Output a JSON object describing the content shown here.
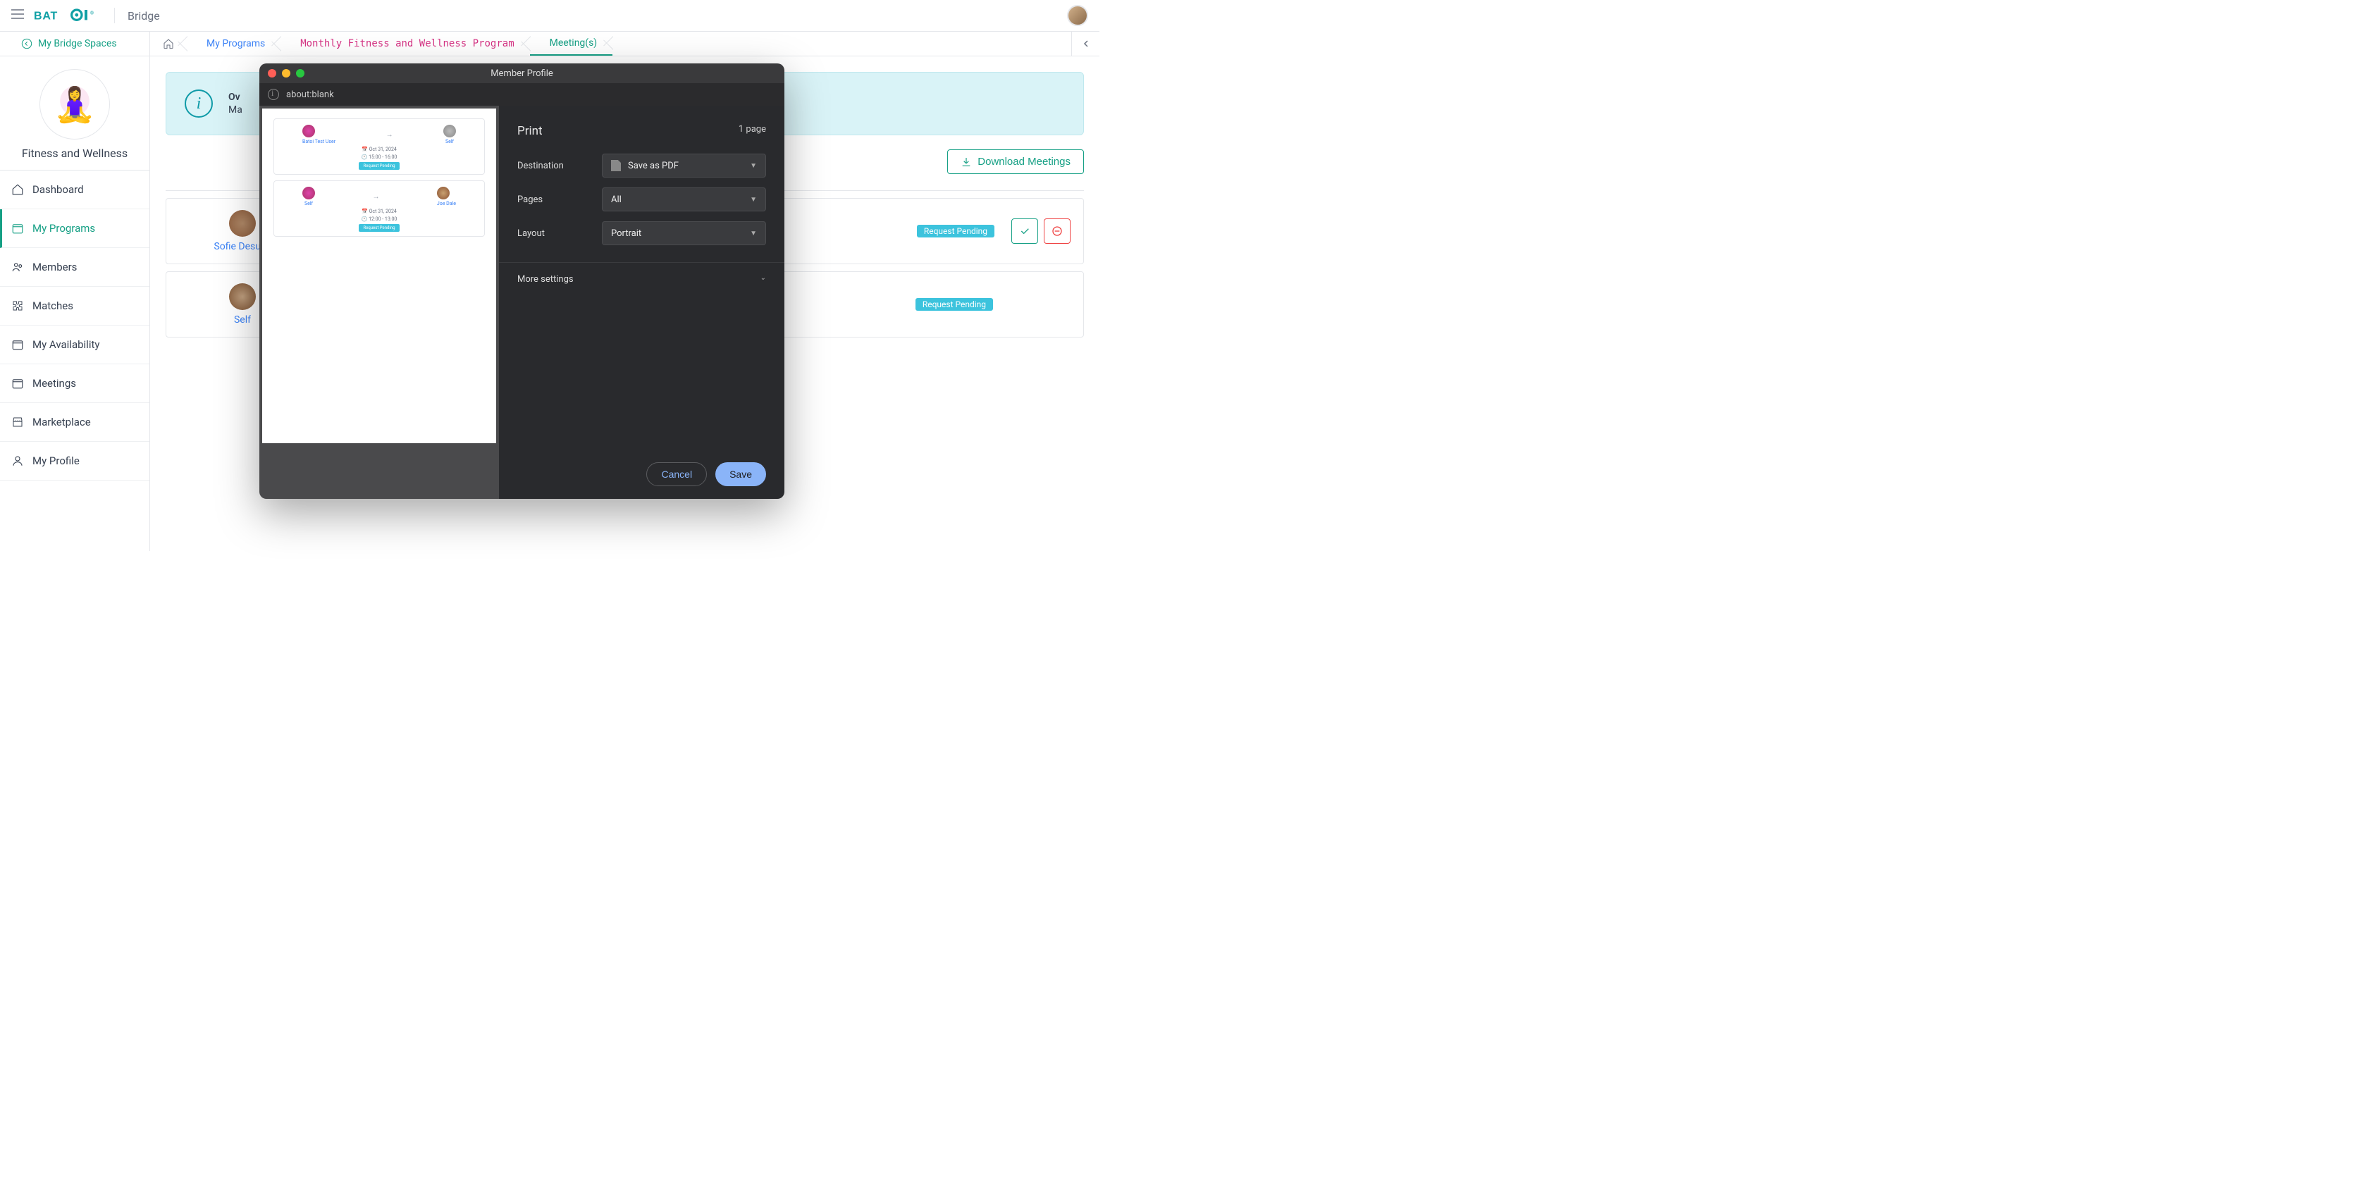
{
  "header": {
    "logo_text": "BATOI",
    "app_name": "Bridge"
  },
  "sec_header": {
    "back_label": "My Bridge Spaces",
    "crumbs": {
      "my_programs": "My Programs",
      "program": "Monthly Fitness and Wellness Program",
      "meetings": "Meeting(s)"
    }
  },
  "sidebar": {
    "space_name": "Fitness and Wellness",
    "items": {
      "dashboard": "Dashboard",
      "my_programs": "My Programs",
      "members": "Members",
      "matches": "Matches",
      "availability": "My Availability",
      "meetings": "Meetings",
      "marketplace": "Marketplace",
      "profile": "My Profile"
    }
  },
  "main": {
    "info_title_prefix": "Ov",
    "info_body_prefix": "Ma",
    "download_label": "Download Meetings",
    "cards": [
      {
        "left_name": "Sofie Desuza",
        "status": "Request Pending"
      },
      {
        "left_name": "Self",
        "status": "Request Pending"
      }
    ]
  },
  "print_dialog": {
    "window_title": "Member Profile",
    "url": "about:blank",
    "title": "Print",
    "page_count": "1 page",
    "labels": {
      "destination": "Destination",
      "pages": "Pages",
      "layout": "Layout",
      "more": "More settings"
    },
    "values": {
      "destination": "Save as PDF",
      "pages": "All",
      "layout": "Portrait"
    },
    "buttons": {
      "cancel": "Cancel",
      "save": "Save"
    },
    "preview": {
      "card1": {
        "left_name": "Batoi Test User",
        "right_name": "Self",
        "date": "Oct 31, 2024",
        "time": "15:00 - 16:00",
        "status": "Request Pending"
      },
      "card2": {
        "left_name": "Self",
        "right_name": "Joe Dale",
        "date": "Oct 31, 2024",
        "time": "12:00 - 13:00",
        "status": "Request Pending"
      }
    }
  }
}
